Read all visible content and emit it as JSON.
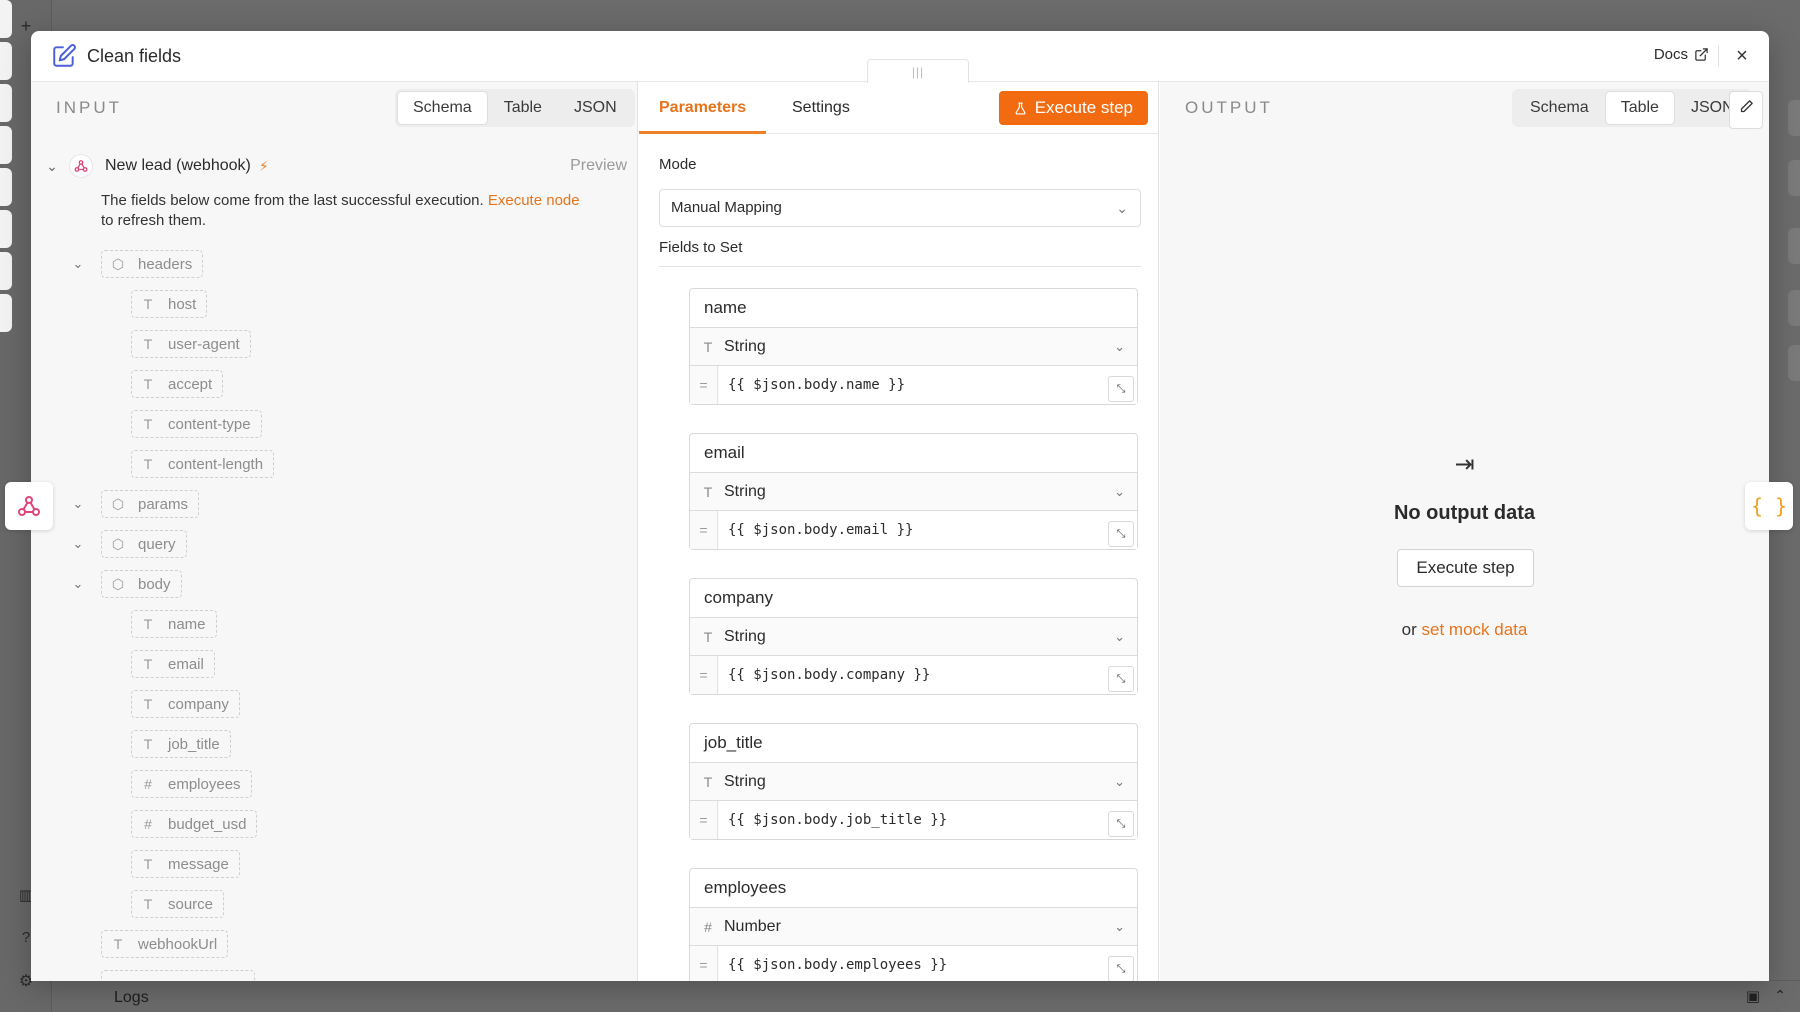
{
  "modal": {
    "title": "Clean fields",
    "docs_label": "Docs",
    "close_label": "×"
  },
  "input": {
    "label": "INPUT",
    "tabs": [
      {
        "label": "Schema",
        "active": true
      },
      {
        "label": "Table",
        "active": false
      },
      {
        "label": "JSON",
        "active": false
      }
    ],
    "source_name": "New lead (webhook)",
    "preview_label": "Preview",
    "info_text": "The fields below come from the last successful execution.",
    "info_link": "Execute node",
    "info_text_after": "to refresh them.",
    "tree": [
      {
        "name": "headers",
        "type_icon": "object",
        "glyph": "⬡",
        "expanded": true
      },
      {
        "name": "host",
        "type_icon": "string",
        "glyph": "T"
      },
      {
        "name": "user-agent",
        "type_icon": "string",
        "glyph": "T"
      },
      {
        "name": "accept",
        "type_icon": "string",
        "glyph": "T"
      },
      {
        "name": "content-type",
        "type_icon": "string",
        "glyph": "T"
      },
      {
        "name": "content-length",
        "type_icon": "string",
        "glyph": "T"
      },
      {
        "name": "params",
        "type_icon": "object",
        "glyph": "⬡",
        "expanded": true
      },
      {
        "name": "query",
        "type_icon": "object",
        "glyph": "⬡",
        "expanded": true
      },
      {
        "name": "body",
        "type_icon": "object",
        "glyph": "⬡",
        "expanded": true
      },
      {
        "name": "name",
        "type_icon": "string",
        "glyph": "T"
      },
      {
        "name": "email",
        "type_icon": "string",
        "glyph": "T"
      },
      {
        "name": "company",
        "type_icon": "string",
        "glyph": "T"
      },
      {
        "name": "job_title",
        "type_icon": "string",
        "glyph": "T"
      },
      {
        "name": "employees",
        "type_icon": "number",
        "glyph": "#"
      },
      {
        "name": "budget_usd",
        "type_icon": "number",
        "glyph": "#"
      },
      {
        "name": "message",
        "type_icon": "string",
        "glyph": "T"
      },
      {
        "name": "source",
        "type_icon": "string",
        "glyph": "T"
      },
      {
        "name": "webhookUrl",
        "type_icon": "string",
        "glyph": "T"
      }
    ]
  },
  "params": {
    "tabs": [
      {
        "label": "Parameters",
        "active": true
      },
      {
        "label": "Settings",
        "active": false
      }
    ],
    "execute_label": "Execute step",
    "mode_label": "Mode",
    "mode_value": "Manual Mapping",
    "fields_label": "Fields to Set",
    "fields": [
      {
        "name": "name",
        "type": "String",
        "type_glyph": "T",
        "value": "{{ $json.body.name }}"
      },
      {
        "name": "email",
        "type": "String",
        "type_glyph": "T",
        "value": "{{ $json.body.email }}"
      },
      {
        "name": "company",
        "type": "String",
        "type_glyph": "T",
        "value": "{{ $json.body.company }}"
      },
      {
        "name": "job_title",
        "type": "String",
        "type_glyph": "T",
        "value": "{{ $json.body.job_title }}"
      },
      {
        "name": "employees",
        "type": "Number",
        "type_glyph": "#",
        "value": "{{ $json.body.employees }}"
      }
    ]
  },
  "output": {
    "label": "OUTPUT",
    "tabs": [
      {
        "label": "Schema",
        "active": false
      },
      {
        "label": "Table",
        "active": true
      },
      {
        "label": "JSON",
        "active": false
      }
    ],
    "empty_title": "No output data",
    "empty_button": "Execute step",
    "mock_prefix": "or",
    "mock_link": "set mock data"
  },
  "background": {
    "logs_label": "Logs"
  },
  "colors": {
    "accent": "#f26b10",
    "accent_text": "#e7741d",
    "webhook_icon": "#e0457b"
  }
}
